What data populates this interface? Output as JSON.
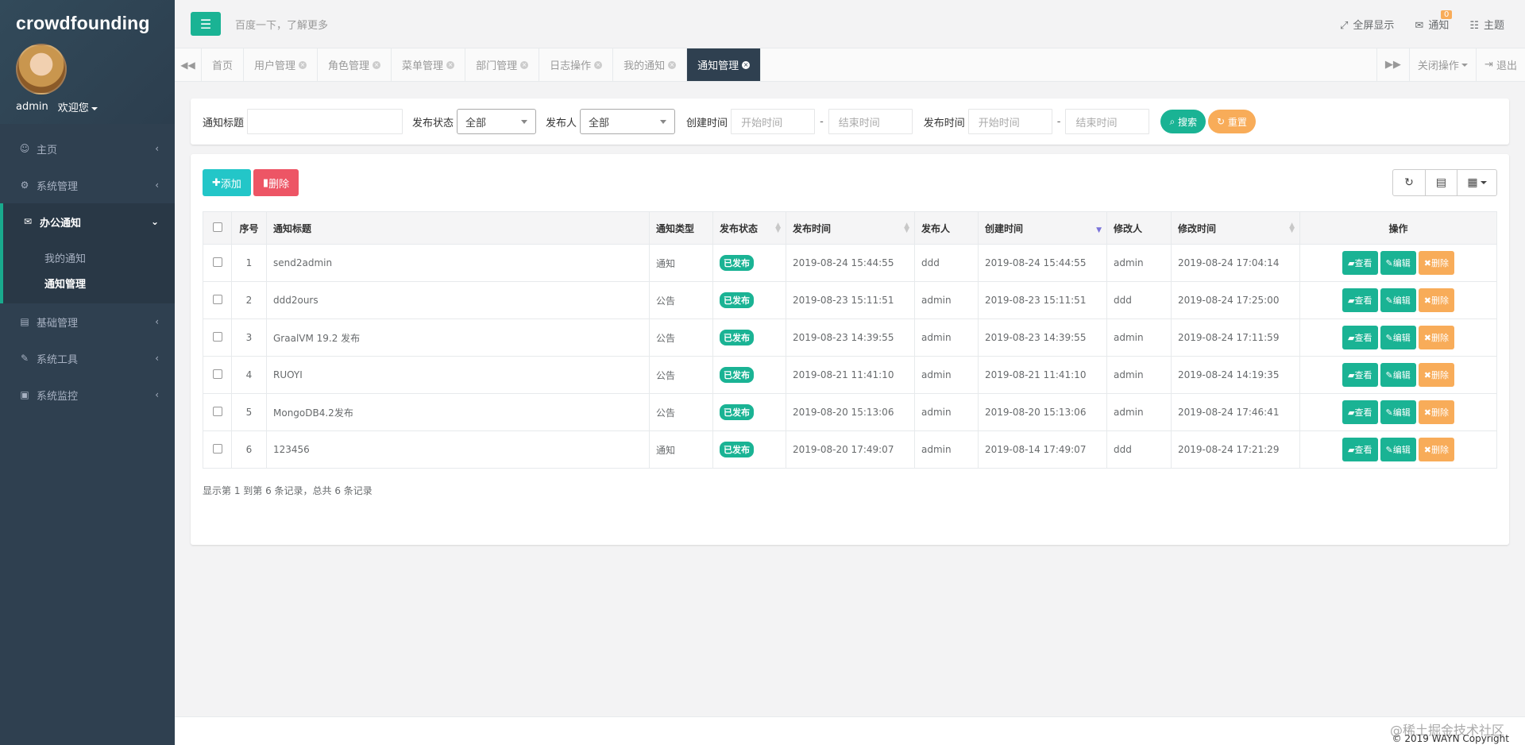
{
  "brand": "crowdfounding",
  "user": {
    "name": "admin",
    "welcome": "欢迎您"
  },
  "nav": {
    "items": [
      {
        "label": "主页",
        "icon": "home-icon"
      },
      {
        "label": "系统管理",
        "icon": "cogs-icon"
      },
      {
        "label": "办公通知",
        "icon": "envelope-icon"
      },
      {
        "label": "基础管理",
        "icon": "id-card-icon"
      },
      {
        "label": "系统工具",
        "icon": "wrench-icon"
      },
      {
        "label": "系统监控",
        "icon": "monitor-icon"
      }
    ],
    "sub": [
      {
        "label": "我的通知"
      },
      {
        "label": "通知管理"
      }
    ]
  },
  "header": {
    "search_placeholder": "百度一下，了解更多",
    "fullscreen": "全屏显示",
    "notify": "通知",
    "notify_count": "0",
    "theme": "主题"
  },
  "tabs": [
    {
      "label": "首页"
    },
    {
      "label": "用户管理"
    },
    {
      "label": "角色管理"
    },
    {
      "label": "菜单管理"
    },
    {
      "label": "部门管理"
    },
    {
      "label": "日志操作"
    },
    {
      "label": "我的通知"
    },
    {
      "label": "通知管理"
    }
  ],
  "tab_actions": {
    "close_ops": "关闭操作",
    "logout": "退出"
  },
  "search": {
    "title_label": "通知标题",
    "status_label": "发布状态",
    "status_value": "全部",
    "publisher_label": "发布人",
    "publisher_value": "全部",
    "create_label": "创建时间",
    "publish_label": "发布时间",
    "start_placeholder": "开始时间",
    "end_placeholder": "结束时间",
    "dash": "-",
    "search_btn": "搜索",
    "reset_btn": "重置"
  },
  "toolbar": {
    "add": "添加",
    "delete": "删除"
  },
  "table": {
    "headers": [
      "序号",
      "通知标题",
      "通知类型",
      "发布状态",
      "发布时间",
      "发布人",
      "创建时间",
      "修改人",
      "修改时间",
      "操作"
    ],
    "rows": [
      {
        "no": "1",
        "title": "send2admin",
        "type": "通知",
        "status": "已发布",
        "pub_time": "2019-08-24 15:44:55",
        "publisher": "ddd",
        "create_time": "2019-08-24 15:44:55",
        "modifier": "admin",
        "mod_time": "2019-08-24 17:04:14"
      },
      {
        "no": "2",
        "title": "ddd2ours",
        "type": "公告",
        "status": "已发布",
        "pub_time": "2019-08-23 15:11:51",
        "publisher": "admin",
        "create_time": "2019-08-23 15:11:51",
        "modifier": "ddd",
        "mod_time": "2019-08-24 17:25:00"
      },
      {
        "no": "3",
        "title": "GraalVM 19.2 发布",
        "type": "公告",
        "status": "已发布",
        "pub_time": "2019-08-23 14:39:55",
        "publisher": "admin",
        "create_time": "2019-08-23 14:39:55",
        "modifier": "admin",
        "mod_time": "2019-08-24 17:11:59"
      },
      {
        "no": "4",
        "title": "RUOYI",
        "type": "公告",
        "status": "已发布",
        "pub_time": "2019-08-21 11:41:10",
        "publisher": "admin",
        "create_time": "2019-08-21 11:41:10",
        "modifier": "admin",
        "mod_time": "2019-08-24 14:19:35"
      },
      {
        "no": "5",
        "title": "MongoDB4.2发布",
        "type": "公告",
        "status": "已发布",
        "pub_time": "2019-08-20 15:13:06",
        "publisher": "admin",
        "create_time": "2019-08-20 15:13:06",
        "modifier": "admin",
        "mod_time": "2019-08-24 17:46:41"
      },
      {
        "no": "6",
        "title": "123456",
        "type": "通知",
        "status": "已发布",
        "pub_time": "2019-08-20 17:49:07",
        "publisher": "admin",
        "create_time": "2019-08-14 17:49:07",
        "modifier": "ddd",
        "mod_time": "2019-08-24 17:21:29"
      }
    ],
    "ops": {
      "view": "查看",
      "edit": "编辑",
      "remove": "删除"
    }
  },
  "pagination": "显示第 1 到第 6 条记录，总共 6 条记录",
  "footer": {
    "watermark": "@稀土掘金技术社区",
    "copyright": "© 2019 WAYN Copyright"
  }
}
